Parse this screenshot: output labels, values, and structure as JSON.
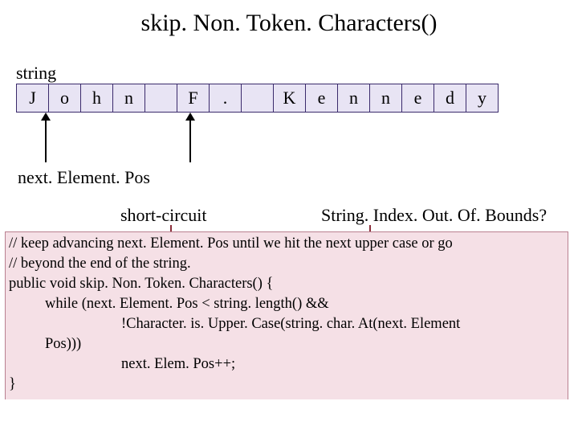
{
  "title": "skip. Non. Token. Characters()",
  "string_label": "string",
  "cells": [
    "J",
    "o",
    "h",
    "n",
    "",
    "F",
    ".",
    "",
    "K",
    "e",
    "n",
    "n",
    "e",
    "d",
    "y"
  ],
  "nextpos_label": "next. Element. Pos",
  "short_circuit": "short-circuit",
  "string_index": "String. Index. Out. Of. Bounds?",
  "code": {
    "c1": "// keep advancing next. Element. Pos until we hit the next upper case or go",
    "c2": "// beyond the end of the string.",
    "c3": "public void skip. Non. Token. Characters() {",
    "c4": "while (next. Element. Pos < string. length() &&",
    "c5": "!Character. is. Upper. Case(string. char. At(next. Element",
    "c6": "Pos)))",
    "c7": "next. Elem. Pos++;",
    "c8": "}"
  }
}
